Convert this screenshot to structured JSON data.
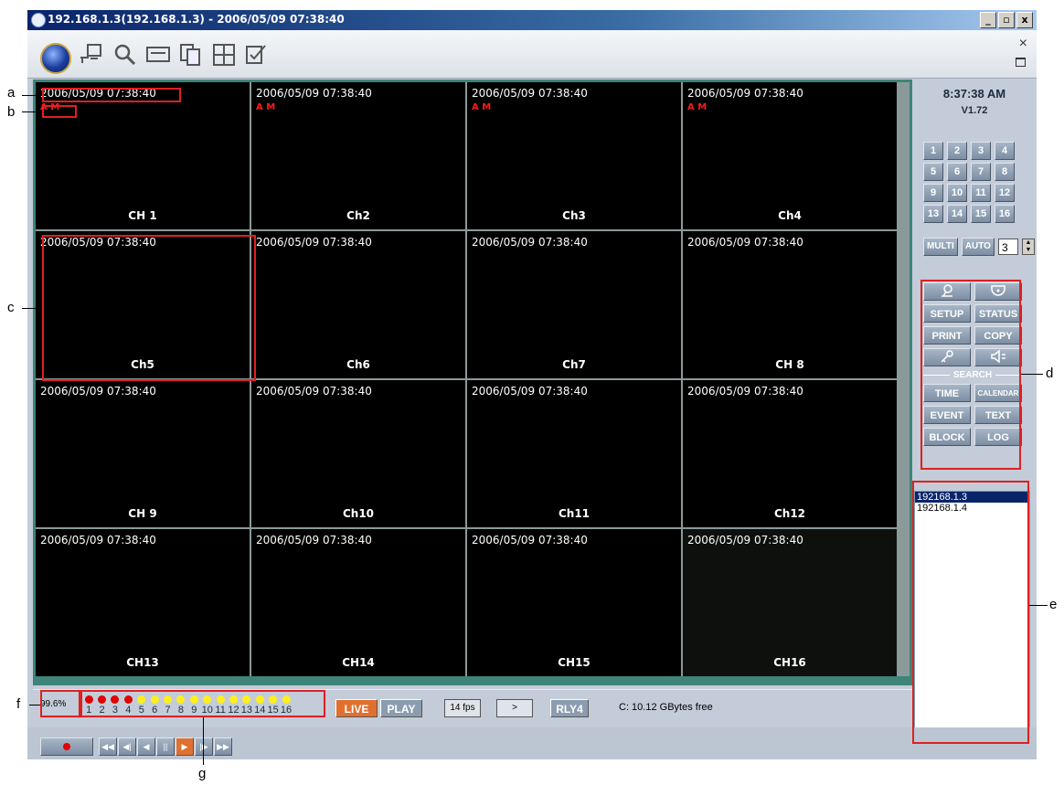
{
  "window": {
    "title": "192.168.1.3(192.168.1.3) - 2006/05/09 07:38:40",
    "buttons": [
      "_",
      "▫",
      "x"
    ]
  },
  "toolbar": {
    "close_glyph": "×"
  },
  "channels": [
    {
      "timestamp": "2006/05/09  07:38:40",
      "alarm": "A M",
      "label": "CH 1"
    },
    {
      "timestamp": "2006/05/09  07:38:40",
      "alarm": "A M",
      "label": "Ch2"
    },
    {
      "timestamp": "2006/05/09  07:38:40",
      "alarm": "A M",
      "label": "Ch3"
    },
    {
      "timestamp": "2006/05/09  07:38:40",
      "alarm": "A M",
      "label": "Ch4"
    },
    {
      "timestamp": "2006/05/09  07:38:40",
      "alarm": "",
      "label": "Ch5"
    },
    {
      "timestamp": "2006/05/09  07:38:40",
      "alarm": "",
      "label": "Ch6"
    },
    {
      "timestamp": "2006/05/09  07:38:40",
      "alarm": "",
      "label": "Ch7"
    },
    {
      "timestamp": "2006/05/09  07:38:40",
      "alarm": "",
      "label": "CH 8"
    },
    {
      "timestamp": "2006/05/09  07:38:40",
      "alarm": "",
      "label": "CH 9"
    },
    {
      "timestamp": "2006/05/09  07:38:40",
      "alarm": "",
      "label": "Ch10"
    },
    {
      "timestamp": "2006/05/09  07:38:40",
      "alarm": "",
      "label": "Ch11"
    },
    {
      "timestamp": "2006/05/09  07:38:40",
      "alarm": "",
      "label": "Ch12"
    },
    {
      "timestamp": "2006/05/09  07:38:40",
      "alarm": "",
      "label": "CH13"
    },
    {
      "timestamp": "2006/05/09  07:38:40",
      "alarm": "",
      "label": "CH14"
    },
    {
      "timestamp": "2006/05/09  07:38:40",
      "alarm": "",
      "label": "CH15"
    },
    {
      "timestamp": "2006/05/09  07:38:40",
      "alarm": "",
      "label": "CH16"
    }
  ],
  "right_panel": {
    "clock": "8:37:38 AM",
    "version": "V1.72",
    "channel_buttons": [
      "1",
      "2",
      "3",
      "4",
      "5",
      "6",
      "7",
      "8",
      "9",
      "10",
      "11",
      "12",
      "13",
      "14",
      "15",
      "16"
    ],
    "multi_label": "MULTI",
    "auto_label": "AUTO",
    "auto_value": "3",
    "functions": {
      "setup": "SETUP",
      "status": "STATUS",
      "print": "PRINT",
      "copy": "COPY",
      "search_header": "SEARCH",
      "time": "TIME",
      "calendar": "CALENDAR",
      "event": "EVENT",
      "text": "TEXT",
      "block": "BLOCK",
      "log": "LOG"
    },
    "dvr_list": [
      "192168.1.3",
      "192168.1.4"
    ]
  },
  "status": {
    "rate": "99.6%",
    "indicators": [
      {
        "n": "1",
        "color": "#e00000"
      },
      {
        "n": "2",
        "color": "#e00000"
      },
      {
        "n": "3",
        "color": "#e00000"
      },
      {
        "n": "4",
        "color": "#e00000"
      },
      {
        "n": "5",
        "color": "#ffee20"
      },
      {
        "n": "6",
        "color": "#ffee20"
      },
      {
        "n": "7",
        "color": "#ffee20"
      },
      {
        "n": "8",
        "color": "#ffee20"
      },
      {
        "n": "9",
        "color": "#ffee20"
      },
      {
        "n": "10",
        "color": "#ffee20"
      },
      {
        "n": "11",
        "color": "#ffee20"
      },
      {
        "n": "12",
        "color": "#ffee20"
      },
      {
        "n": "13",
        "color": "#ffee20"
      },
      {
        "n": "14",
        "color": "#ffee20"
      },
      {
        "n": "15",
        "color": "#ffee20"
      },
      {
        "n": "16",
        "color": "#ffee20"
      }
    ],
    "live_label": "LIVE",
    "play_label": "PLAY",
    "fps": "14 fps",
    "next": ">",
    "relay": "RLY4",
    "disk": "C: 10.12 GBytes free"
  },
  "playback": [
    "◀◀",
    "◀|",
    "◀",
    "||",
    "▶",
    "|▶",
    "▶▶"
  ],
  "annotations": [
    "a",
    "b",
    "c",
    "d",
    "e",
    "f",
    "g"
  ],
  "colors": {
    "grid_border": "#3e8478",
    "panel_bg": "#c3ccd8",
    "button_blue": "#8b9cb0",
    "live_button": "#e07030",
    "play_button": "#8b9cb0",
    "annotation": "#e02020"
  }
}
